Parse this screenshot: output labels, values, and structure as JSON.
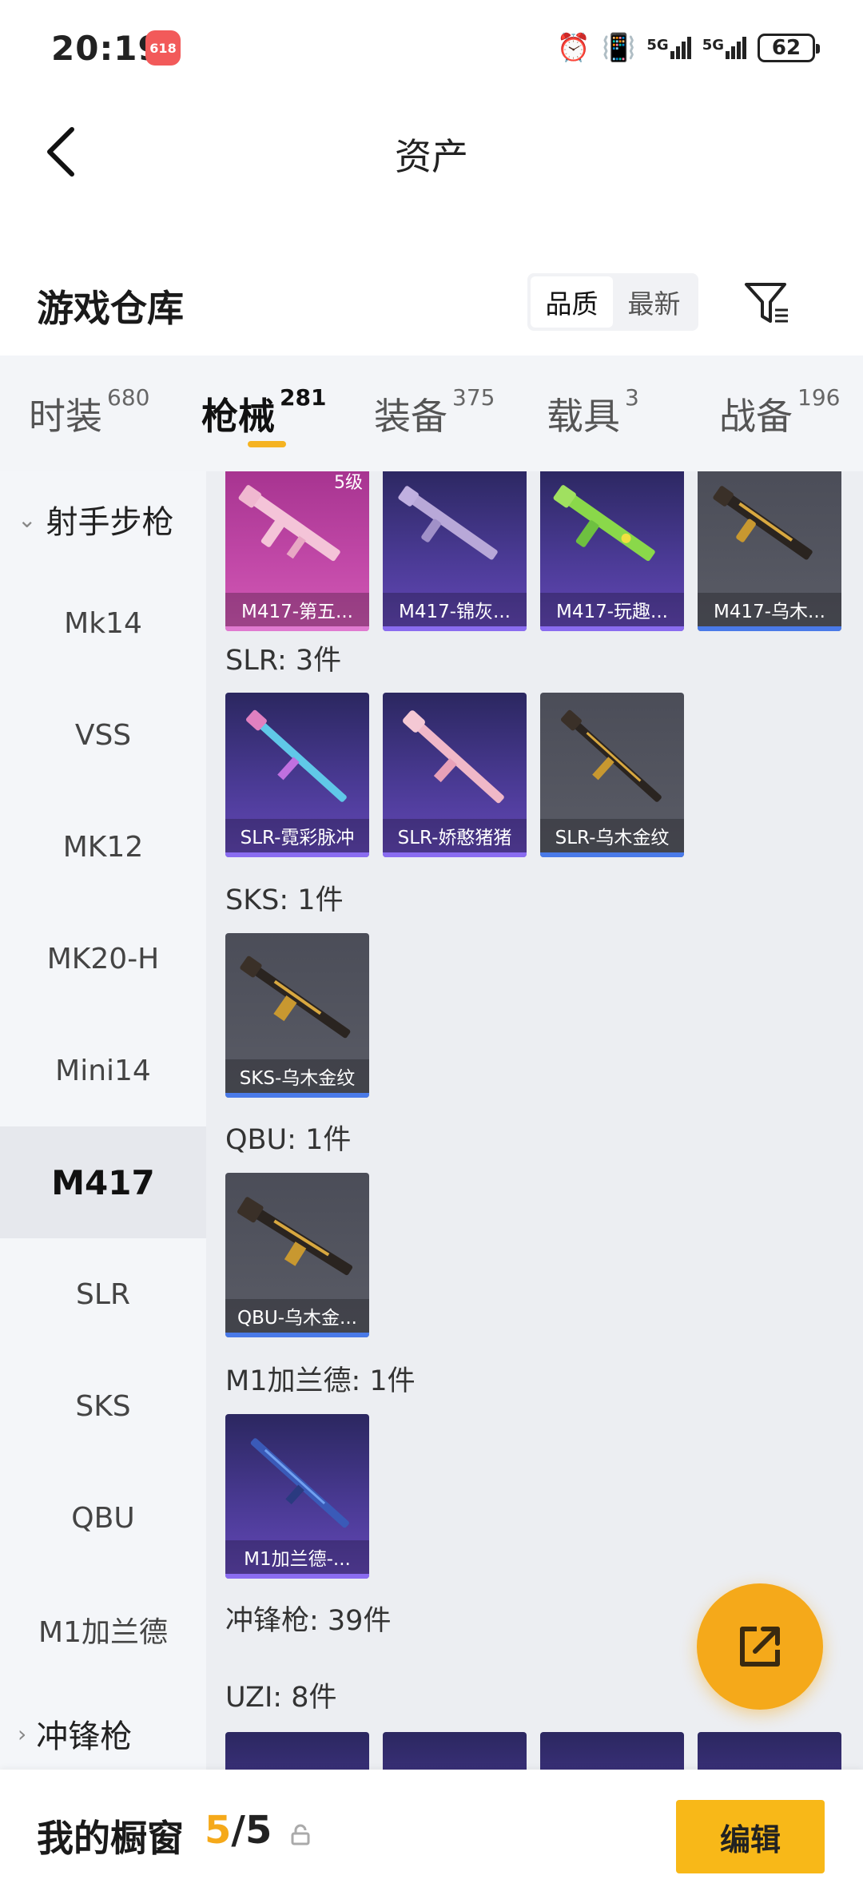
{
  "status_bar": {
    "time": "20:19",
    "badge": "618",
    "battery": "62",
    "network1": "5G",
    "network2": "5G"
  },
  "nav": {
    "title": "资产",
    "back_icon": "chevron-left-icon"
  },
  "warehouse": {
    "title": "游戏仓库",
    "sort_options": [
      "品质",
      "最新"
    ],
    "sort_selected": "品质",
    "filter_icon": "filter-icon"
  },
  "tabs": [
    {
      "label": "时装",
      "count": "680"
    },
    {
      "label": "枪械",
      "count": "281"
    },
    {
      "label": "装备",
      "count": "375"
    },
    {
      "label": "载具",
      "count": "3"
    },
    {
      "label": "战备",
      "count": "196"
    }
  ],
  "active_tab": "枪械",
  "sidebar": {
    "groups": [
      {
        "label": "射手步枪",
        "expanded": true
      },
      {
        "label": "冲锋枪",
        "expanded": false
      }
    ],
    "items": [
      "Mk14",
      "VSS",
      "MK12",
      "MK20-H",
      "Mini14",
      "M417",
      "SLR",
      "SKS",
      "QBU",
      "M1加兰德"
    ],
    "active_item": "M417"
  },
  "content": {
    "m417_items": [
      {
        "name": "M417-第五...",
        "quality": "pink",
        "grade": "5级"
      },
      {
        "name": "M417-锦灰...",
        "quality": "purple"
      },
      {
        "name": "M417-玩趣...",
        "quality": "purple"
      },
      {
        "name": "M417-乌木...",
        "quality": "gold"
      }
    ],
    "slr": {
      "label": "SLR: 3件",
      "items": [
        {
          "name": "SLR-霓彩脉冲",
          "quality": "purple"
        },
        {
          "name": "SLR-娇憨猪猪",
          "quality": "purple"
        },
        {
          "name": "SLR-乌木金纹",
          "quality": "gold"
        }
      ]
    },
    "sks": {
      "label": "SKS: 1件",
      "items": [
        {
          "name": "SKS-乌木金纹",
          "quality": "gold"
        }
      ]
    },
    "qbu": {
      "label": "QBU: 1件",
      "items": [
        {
          "name": "QBU-乌木金...",
          "quality": "gold"
        }
      ]
    },
    "m1": {
      "label": "M1加兰德: 1件",
      "items": [
        {
          "name": "M1加兰德-...",
          "quality": "purple"
        }
      ]
    },
    "smg_label": "冲锋枪: 39件",
    "uzi_label": "UZI: 8件"
  },
  "fab_icon": "share-icon",
  "bottom_bar": {
    "title": "我的橱窗",
    "current": "5",
    "separator": "/",
    "max": "5",
    "lock_icon": "lock-icon",
    "edit_label": "编辑"
  },
  "colors": {
    "accent": "#f5a91a",
    "edit_button": "#f8b818",
    "purple_quality": "#6448b8",
    "pink_quality": "#c249a8",
    "gold_quality": "#5a5c66"
  }
}
